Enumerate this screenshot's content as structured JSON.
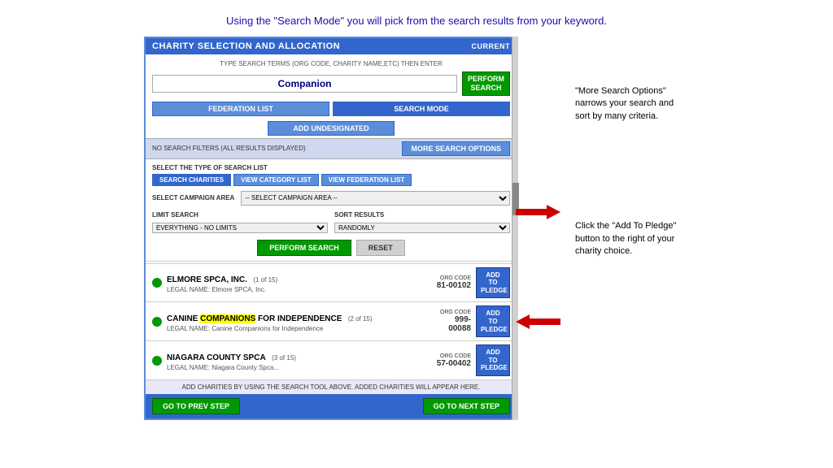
{
  "header": {
    "instruction": "Using the \"Search Mode\" you will pick from the search results from your keyword."
  },
  "panel": {
    "title": "CHARITY SELECTION AND ALLOCATION",
    "current_label": "CURRENT",
    "type_instruction": "TYPE SEARCH TERMS (ORG CODE, CHARITY NAME,ETC) THEN ENTER",
    "search_value": "Companion",
    "btn_perform_search_top": "PERFORM\nSEARCH",
    "btn_federation_list": "FEDERATION LIST",
    "btn_search_mode": "SEARCH MODE",
    "btn_add_undesignated": "ADD UNDESIGNATED",
    "results_text": "NO SEARCH FILTERS (ALL RESULTS DISPLAYED)",
    "btn_more_search": "MORE SEARCH OPTIONS",
    "select_type_label": "SELECT THE TYPE OF SEARCH LIST",
    "btn_search_charities": "SEARCH CHARITIES",
    "btn_view_category": "VIEW CATEGORY LIST",
    "btn_view_federation": "VIEW FEDERATION LIST",
    "campaign_area_label": "SELECT CAMPAIGN AREA",
    "campaign_area_default": "-- SELECT CAMPAIGN AREA --",
    "limit_label": "LIMIT SEARCH",
    "limit_default": "EVERYTHING - NO LIMITS",
    "sort_label": "SORT RESULTS",
    "sort_default": "RANDOMLY",
    "btn_perform_search": "PERFORM SEARCH",
    "btn_reset": "RESET",
    "footer_note": "ADD CHARITIES BY USING THE SEARCH TOOL ABOVE. ADDED CHARITIES WILL APPEAR HERE.",
    "btn_prev": "GO TO PREV STEP",
    "btn_next": "GO TO NEXT STEP",
    "results": [
      {
        "name": "ELMORE SPCA, INC.",
        "count": "(1 of 15)",
        "legal": "LEGAL NAME: Elmore SPCA, Inc.",
        "org_code": "81-00102",
        "btn_label": "ADD TO\nPLEDGE",
        "highlighted": ""
      },
      {
        "name": "CANINE COMPANIONS FOR INDEPENDENCE",
        "count": "(2 of 15)",
        "legal": "LEGAL NAME: Canine Companions for Independence",
        "org_code": "999-\n00088",
        "btn_label": "ADD TO\nPLEDGE",
        "highlighted": "COMPANIONS"
      },
      {
        "name": "NIAGARA COUNTY SPCA",
        "count": "(3 of 15)",
        "legal": "LEGAL NAME: Niagara County Spca...",
        "org_code": "57-00402",
        "btn_label": "ADD TO\nPLEDGE",
        "highlighted": ""
      }
    ]
  },
  "annotations": {
    "top": "\"More Search Options\" narrows your search and sort by many criteria.",
    "bottom": "Click the \"Add To Pledge\" button to the right of your charity choice."
  }
}
